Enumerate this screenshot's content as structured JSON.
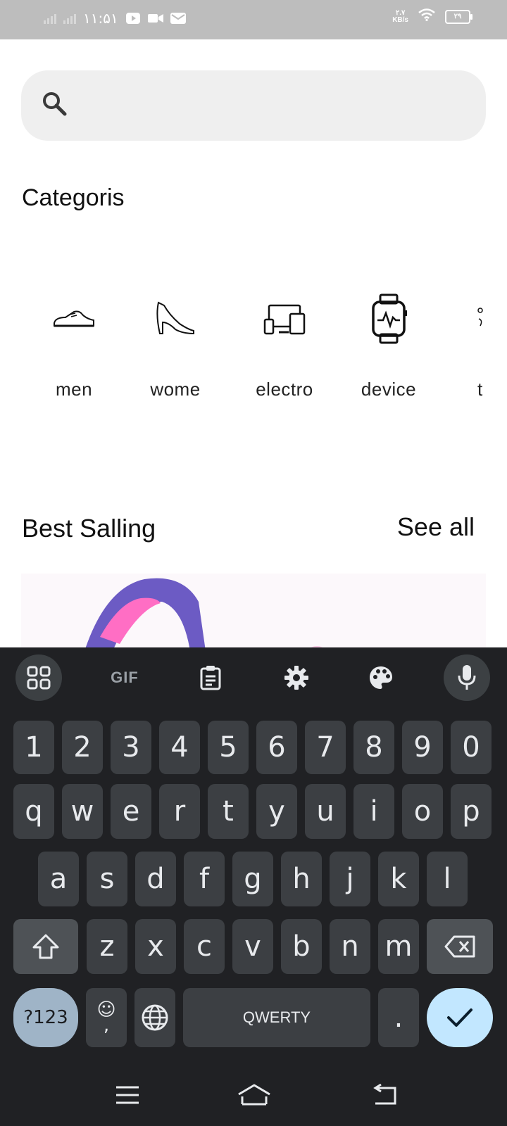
{
  "status_bar": {
    "time": "۱۱:۵۱",
    "net_speed_value": "۲.۷",
    "net_speed_unit": "KB/s",
    "battery": "۲۹"
  },
  "search": {
    "placeholder": "",
    "value": ""
  },
  "categories": {
    "title": "Categoris",
    "items": [
      {
        "label": "men",
        "icon": "shoe-icon"
      },
      {
        "label": "wome",
        "icon": "high-heel-icon"
      },
      {
        "label": "electro",
        "icon": "devices-icon"
      },
      {
        "label": "device",
        "icon": "smartwatch-icon"
      },
      {
        "label": "t",
        "icon": "item-icon"
      }
    ]
  },
  "best_selling": {
    "title": "Best Salling",
    "see_all": "See all"
  },
  "keyboard": {
    "toolbar": {
      "gif": "GIF"
    },
    "rows": {
      "numbers": [
        "1",
        "2",
        "3",
        "4",
        "5",
        "6",
        "7",
        "8",
        "9",
        "0"
      ],
      "row1": [
        "q",
        "w",
        "e",
        "r",
        "t",
        "y",
        "u",
        "i",
        "o",
        "p"
      ],
      "row2": [
        "a",
        "s",
        "d",
        "f",
        "g",
        "h",
        "j",
        "k",
        "l"
      ],
      "row3": [
        "z",
        "x",
        "c",
        "v",
        "b",
        "n",
        "m"
      ]
    },
    "symbols_label": "?123",
    "emoji_comma": ",",
    "space_label": "QWERTY",
    "period": "."
  },
  "colors": {
    "keyboard_bg": "#202124",
    "key_bg": "#3c3f43",
    "enter_bg": "#c2e7ff",
    "symbols_bg": "#9fb4c7"
  }
}
